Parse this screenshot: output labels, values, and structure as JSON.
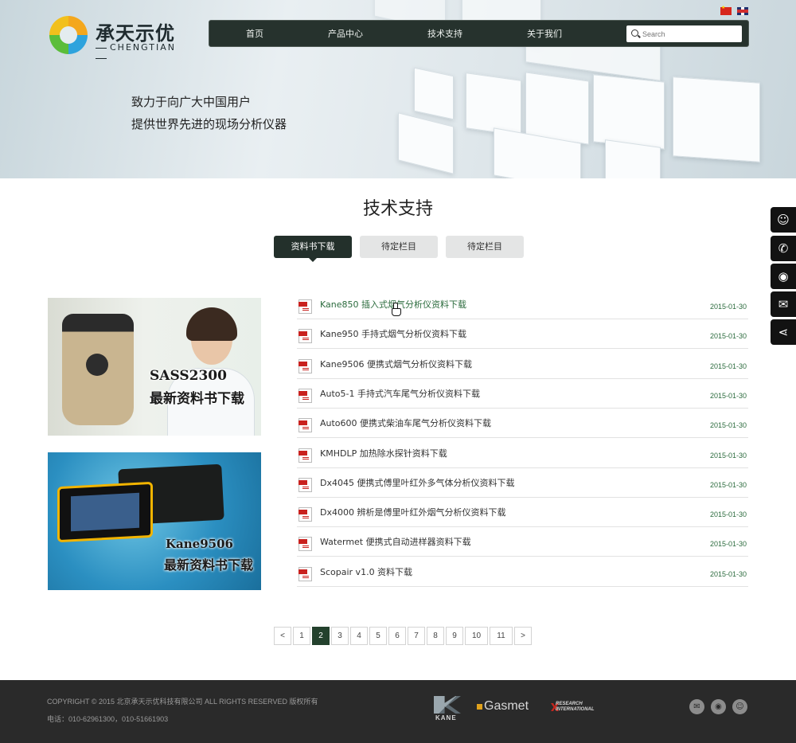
{
  "header": {
    "logo_cn": "承天示优",
    "logo_en": "CHENGTIAN",
    "nav": [
      "首页",
      "产品中心",
      "技术支持",
      "关于我们"
    ],
    "search_placeholder": "Search",
    "slogan_line1": "致力于向广大中国用户",
    "slogan_line2": "提供世界先进的现场分析仪器"
  },
  "section": {
    "title": "技术支持",
    "tabs": [
      "资料书下载",
      "待定栏目",
      "待定栏目"
    ],
    "active_tab": 0
  },
  "promos": [
    {
      "caption_line1": "SASS2300",
      "caption_line2": "最新资料书下载"
    },
    {
      "caption_line1": "Kane9506",
      "caption_line2": "最新资料书下载"
    }
  ],
  "downloads": [
    {
      "title": "Kane850 插入式烟气分析仪资料下载",
      "date": "2015-01-30"
    },
    {
      "title": "Kane950 手持式烟气分析仪资料下载",
      "date": "2015-01-30"
    },
    {
      "title": "Kane9506 便携式烟气分析仪资料下载",
      "date": "2015-01-30"
    },
    {
      "title": "Auto5-1 手持式汽车尾气分析仪资料下载",
      "date": "2015-01-30"
    },
    {
      "title": "Auto600 便携式柴油车尾气分析仪资料下载",
      "date": "2015-01-30"
    },
    {
      "title": "KMHDLP 加热除水探针资料下载",
      "date": "2015-01-30"
    },
    {
      "title": "Dx4045 便携式傅里叶红外多气体分析仪资料下载",
      "date": "2015-01-30"
    },
    {
      "title": "Dx4000 辨析是傅里叶红外烟气分析仪资料下载",
      "date": "2015-01-30"
    },
    {
      "title": "Watermet 便携式自动进样器资料下载",
      "date": "2015-01-30"
    },
    {
      "title": "Scopair v1.0 资料下载",
      "date": "2015-01-30"
    }
  ],
  "pagination": {
    "prev": "<",
    "next": ">",
    "pages": [
      "1",
      "2",
      "3",
      "4",
      "5",
      "6",
      "7",
      "8",
      "9",
      "10",
      "11"
    ],
    "current": "2"
  },
  "side_float": [
    "qq-icon",
    "phone-icon",
    "weibo-icon",
    "wechat-icon",
    "share-icon"
  ],
  "footer": {
    "copyright": "COPYRIGHT © 2015 北京承天示优科技有限公司 ALL RIGHTS RESERVED 版权所有",
    "phone": "电话：010-62961300，010-51661903",
    "brands": [
      "KANE",
      "Gasmet",
      "RESEARCH INTERNATIONAL"
    ]
  },
  "colors": {
    "accent": "#23302b",
    "link_green": "#2b6b3d",
    "pdf_red": "#c9211e",
    "footer_bg": "#2a2a2a"
  }
}
